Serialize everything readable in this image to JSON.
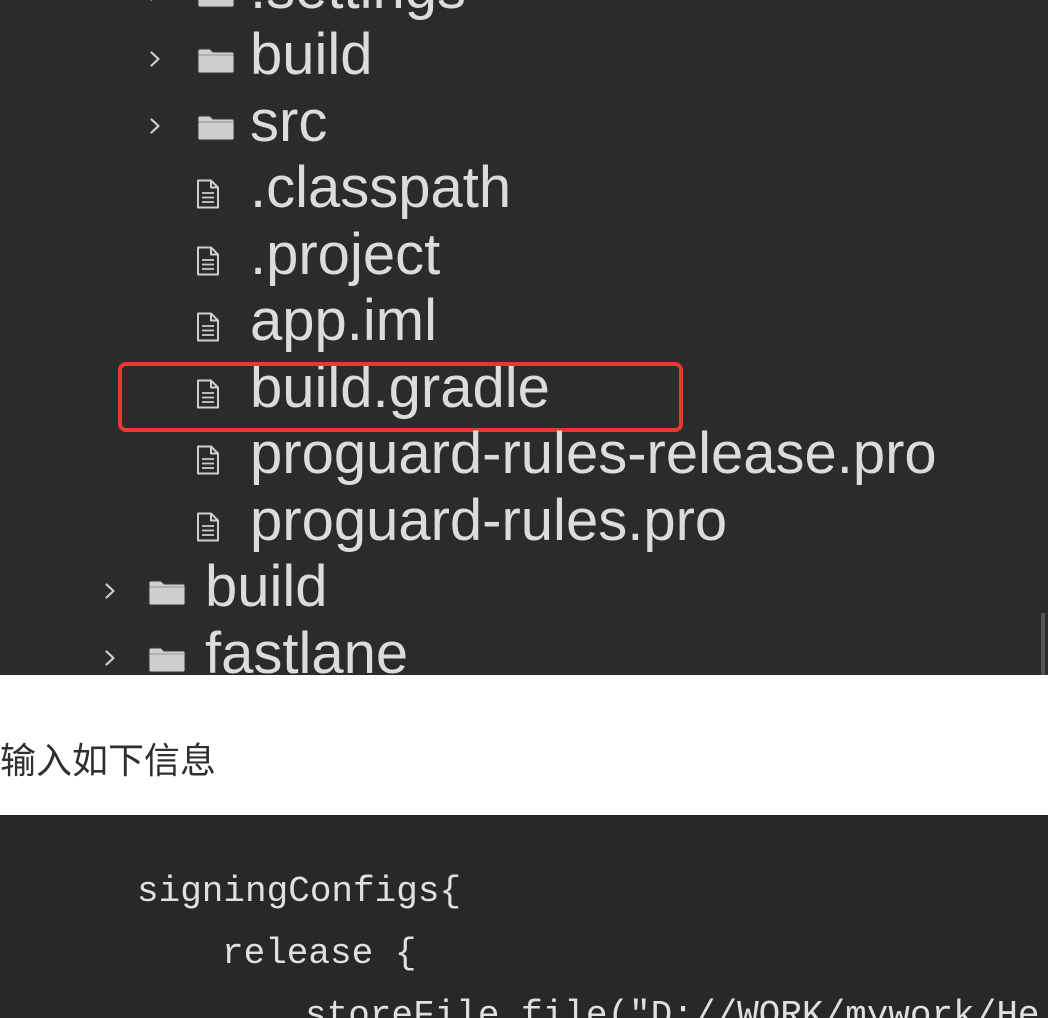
{
  "colors": {
    "tree_background": "#2b2b2b",
    "tree_text": "#dcdcdc",
    "icon": "#cfcfcf",
    "highlight": "#e8382f",
    "page_background": "#ffffff",
    "body_text": "#2f2f2f",
    "code_background": "#282828",
    "code_text": "#e0e0e0"
  },
  "screenshot": {
    "file_tree": {
      "rows": [
        {
          "label": ".settings",
          "icon": "folder-icon",
          "depth": 2,
          "collapsed": true
        },
        {
          "label": "build",
          "icon": "folder-icon",
          "depth": 2,
          "collapsed": true
        },
        {
          "label": "src",
          "icon": "folder-icon",
          "depth": 2,
          "collapsed": true
        },
        {
          "label": ".classpath",
          "icon": "file-icon",
          "depth": 2
        },
        {
          "label": ".project",
          "icon": "file-icon",
          "depth": 2
        },
        {
          "label": "app.iml",
          "icon": "file-icon",
          "depth": 2
        },
        {
          "label": "build.gradle",
          "icon": "file-icon",
          "depth": 2,
          "highlighted": true
        },
        {
          "label": "proguard-rules-release.pro",
          "icon": "file-icon",
          "depth": 2
        },
        {
          "label": "proguard-rules.pro",
          "icon": "file-icon",
          "depth": 2
        },
        {
          "label": "build",
          "icon": "folder-icon",
          "depth": 1,
          "collapsed": true
        },
        {
          "label": "fastlane",
          "icon": "folder-icon",
          "depth": 1,
          "collapsed": true
        }
      ]
    }
  },
  "article": {
    "paragraph": "输入如下信息",
    "code_block": {
      "lines": [
        "signingConfigs{",
        "release {",
        "storeFile file(\"D://WORK/mywork/He"
      ]
    }
  }
}
